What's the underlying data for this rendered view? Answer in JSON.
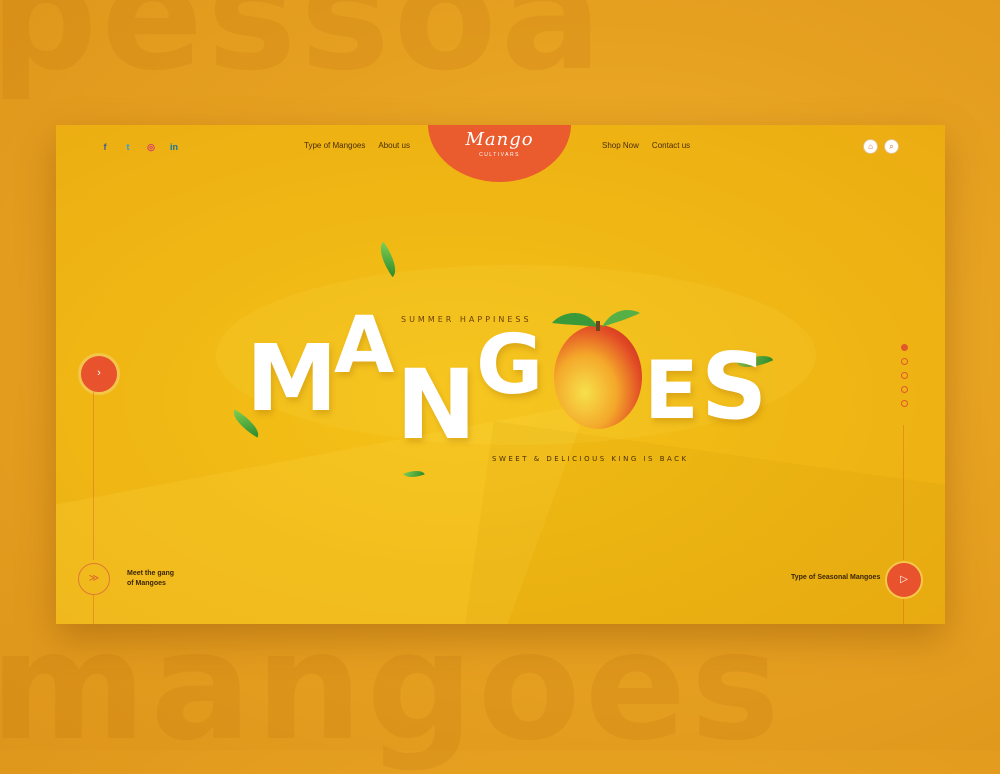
{
  "background_text": {
    "top": "pessoa",
    "bottom": "mangoes"
  },
  "header": {
    "social": [
      {
        "icon": "facebook-icon",
        "glyph": "f",
        "color": "#3b5998"
      },
      {
        "icon": "twitter-icon",
        "glyph": "t",
        "color": "#1da1f2"
      },
      {
        "icon": "instagram-icon",
        "glyph": "◎",
        "color": "#d83a6a"
      },
      {
        "icon": "linkedin-icon",
        "glyph": "in",
        "color": "#0e76a8"
      }
    ],
    "nav_left": [
      "Type of Mangoes",
      "About us"
    ],
    "nav_right": [
      "Shop Now",
      "Contact us"
    ],
    "logo": {
      "script": "Mango",
      "subtitle": "CULTIVARS",
      "color": "#ea5b2e"
    },
    "cart_icon": "⌂",
    "search_icon": "⌕"
  },
  "hero": {
    "tagline_top": "SUMMER HAPPINESS",
    "headline": "MANGOES",
    "tagline_bottom": "SWEET & DELICIOUS KING IS BACK"
  },
  "left_tab_icon": "›",
  "slides": {
    "count": 5,
    "active": 0
  },
  "bottom_left": {
    "line1": "Meet the gang",
    "line2": "of Mangoes",
    "icon": "≫"
  },
  "bottom_right": {
    "label": "Type of Seasonal Mangoes",
    "icon": "▷"
  },
  "colors": {
    "accent": "#e8522c",
    "card": "#f0b814",
    "backdrop": "#e6a020"
  }
}
